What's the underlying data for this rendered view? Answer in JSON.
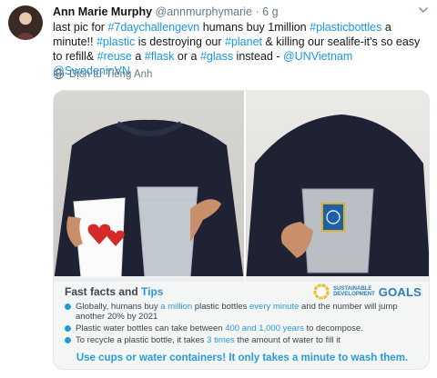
{
  "tweet": {
    "author_name": "Ann Marie Murphy",
    "author_handle": "@annmurphymarie",
    "separator": "·",
    "time": "6 g",
    "text_parts": [
      {
        "t": "last pic for ",
        "link": false
      },
      {
        "t": "#7daychallengevn",
        "link": true
      },
      {
        "t": " humans buy 1million ",
        "link": false
      },
      {
        "t": "#plasticbottles",
        "link": true
      },
      {
        "t": " a minute!! ",
        "link": false
      },
      {
        "t": "#plastic",
        "link": true
      },
      {
        "t": " is destroying our ",
        "link": false
      },
      {
        "t": "#planet",
        "link": true
      },
      {
        "t": " & killing our sealife-it's so easy to refill& ",
        "link": false
      },
      {
        "t": "#reuse",
        "link": true
      },
      {
        "t": " a ",
        "link": false
      },
      {
        "t": "#flask",
        "link": true
      },
      {
        "t": " or a ",
        "link": false
      },
      {
        "t": "#glass",
        "link": true
      },
      {
        "t": " instead - ",
        "link": false
      },
      {
        "t": "@UNVietnam",
        "link": true
      },
      {
        "t": " ",
        "link": false
      },
      {
        "t": "@SwedeninVN",
        "link": true
      }
    ],
    "translate_label": "Dịch từ Tiếng Anh"
  },
  "media": {
    "title_part1": "Fast facts and ",
    "title_part2": "Tips",
    "sdg_line1": "SUSTAINABLE",
    "sdg_line2": "DEVELOPMENT",
    "sdg_goals": "GOALS",
    "bullet1": [
      {
        "t": "Globally, humans buy ",
        "hl": false
      },
      {
        "t": "a million",
        "hl": true
      },
      {
        "t": " plastic bottles ",
        "hl": false
      },
      {
        "t": "every minute",
        "hl": true
      },
      {
        "t": " and the number will jump another 20% by 2021",
        "hl": false
      }
    ],
    "bullet2": [
      {
        "t": "Plastic water bottles can take between ",
        "hl": false
      },
      {
        "t": "400 and 1,000 years",
        "hl": true
      },
      {
        "t": " to decompose.",
        "hl": false
      }
    ],
    "bullet3": [
      {
        "t": "To recycle a plastic bottle, it takes ",
        "hl": false
      },
      {
        "t": "3 times",
        "hl": true
      },
      {
        "t": " the amount of water to fill it",
        "hl": false
      }
    ],
    "cta": "Use cups or water containers! It only takes a minute to wash them."
  },
  "colors": {
    "link": "#1b95e0",
    "highlight": "#2a9bd6",
    "muted": "#657786"
  },
  "icons": {
    "menu": "chevron-down-icon",
    "translate": "globe-icon",
    "sdg": "sdg-wheel-icon"
  }
}
